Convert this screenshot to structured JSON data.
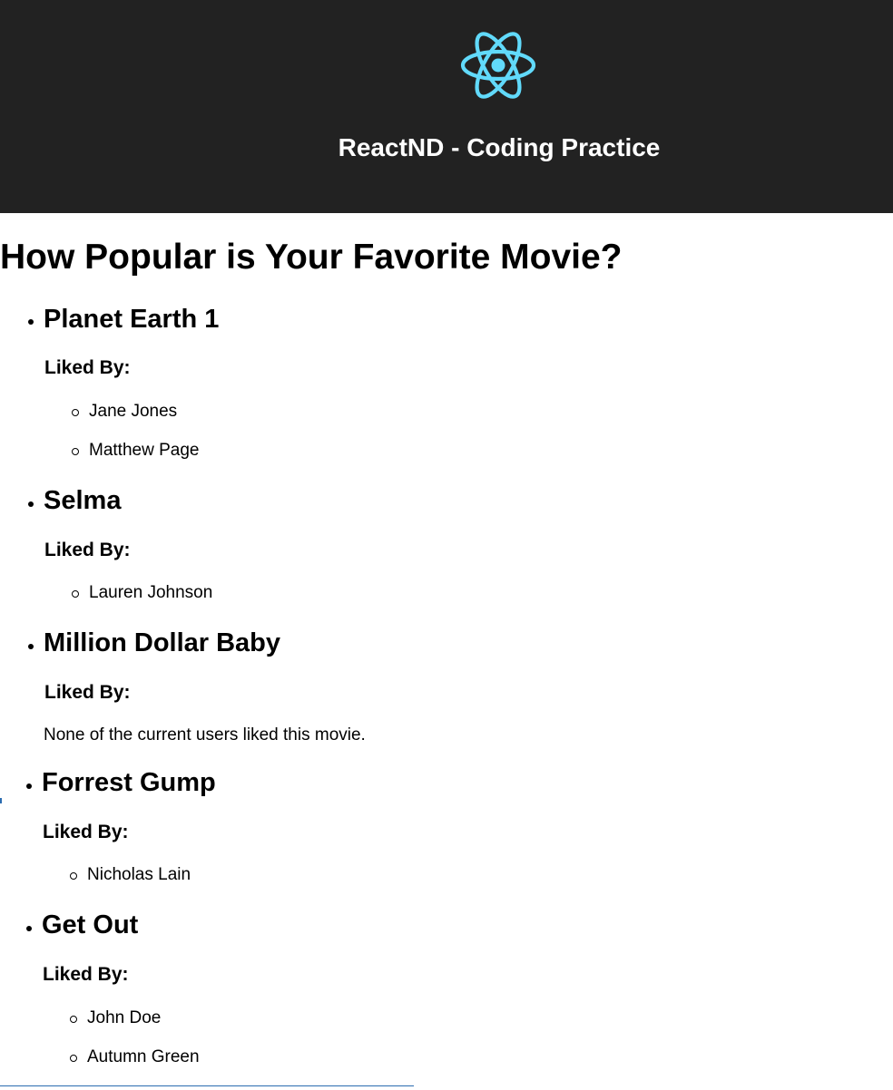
{
  "header": {
    "title": "ReactND - Coding Practice",
    "logo": "react-atom-logo",
    "background": "#222222",
    "logo_color": "#61dafb"
  },
  "main": {
    "heading": "How Popular is Your Favorite Movie?",
    "liked_by_label": "Liked By:",
    "movies": [
      {
        "title": "Planet Earth 1",
        "liked_by": [
          "Jane Jones",
          "Matthew Page"
        ]
      },
      {
        "title": "Selma",
        "liked_by": [
          "Lauren Johnson"
        ]
      },
      {
        "title": "Million Dollar Baby",
        "liked_by": [],
        "empty_message": "None of the current users liked this movie."
      },
      {
        "title": "Forrest Gump",
        "liked_by": [
          "Nicholas Lain"
        ]
      },
      {
        "title": "Get Out",
        "liked_by": [
          "John Doe",
          "Autumn Green"
        ]
      }
    ]
  }
}
